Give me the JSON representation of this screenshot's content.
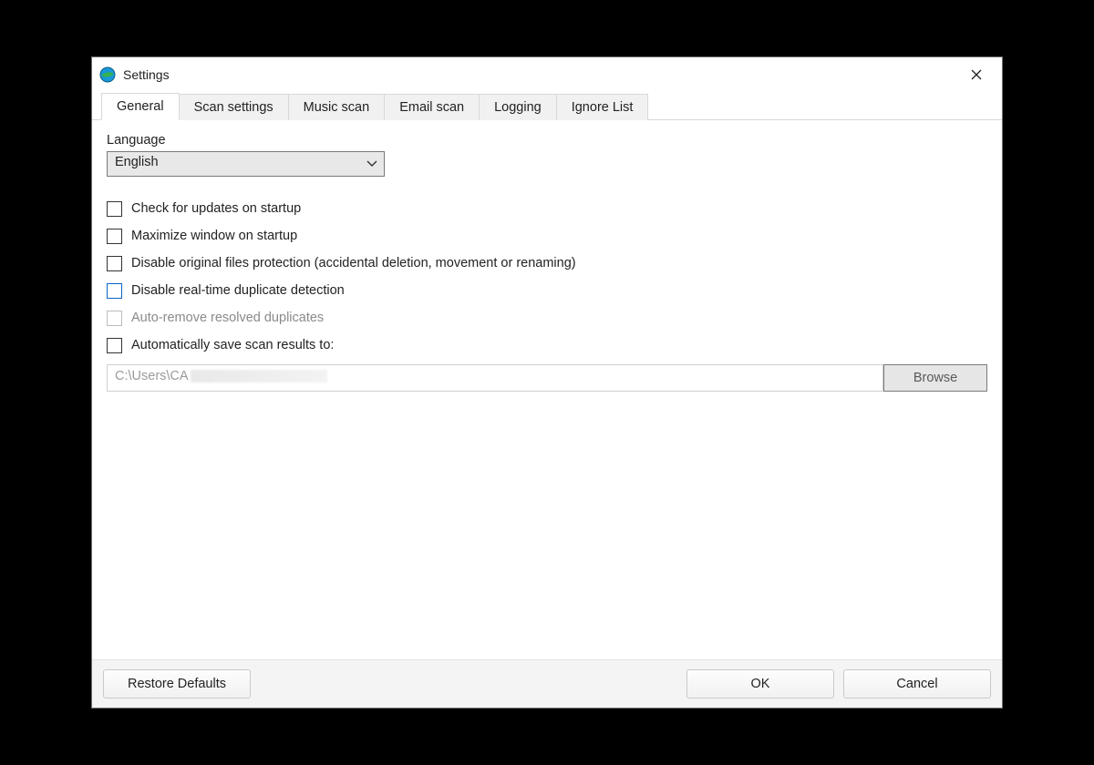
{
  "window": {
    "title": "Settings"
  },
  "tabs": [
    {
      "label": "General",
      "active": true
    },
    {
      "label": "Scan settings",
      "active": false
    },
    {
      "label": "Music scan",
      "active": false
    },
    {
      "label": "Email scan",
      "active": false
    },
    {
      "label": "Logging",
      "active": false
    },
    {
      "label": "Ignore List",
      "active": false
    }
  ],
  "general": {
    "language_label": "Language",
    "language_value": "English",
    "checks": [
      {
        "label": "Check for updates on startup",
        "checked": false,
        "disabled": false,
        "focused": false
      },
      {
        "label": "Maximize window on startup",
        "checked": false,
        "disabled": false,
        "focused": false
      },
      {
        "label": "Disable original files protection (accidental deletion, movement or renaming)",
        "checked": false,
        "disabled": false,
        "focused": false
      },
      {
        "label": "Disable real-time duplicate detection",
        "checked": false,
        "disabled": false,
        "focused": true
      },
      {
        "label": "Auto-remove resolved duplicates",
        "checked": false,
        "disabled": true,
        "focused": false
      },
      {
        "label": "Automatically save scan results to:",
        "checked": false,
        "disabled": false,
        "focused": false
      }
    ],
    "save_path_visible_prefix": "C:\\Users\\CA",
    "browse_label": "Browse"
  },
  "footer": {
    "restore_label": "Restore Defaults",
    "ok_label": "OK",
    "cancel_label": "Cancel"
  }
}
